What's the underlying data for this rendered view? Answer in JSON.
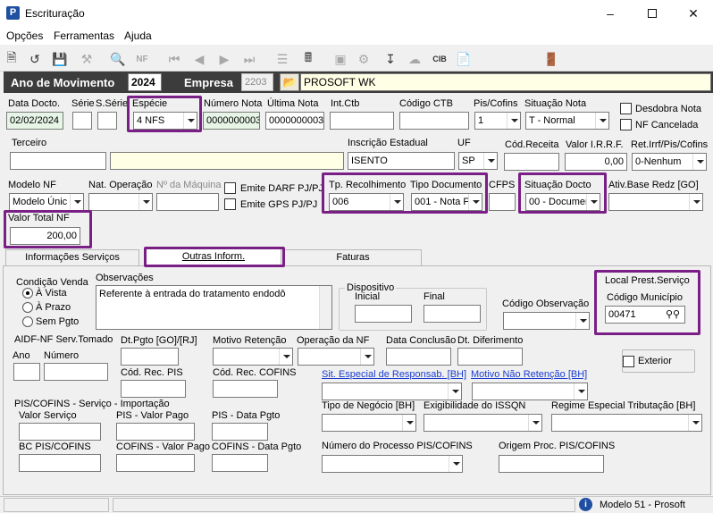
{
  "window": {
    "title": "Escrituração"
  },
  "menu": [
    "Opções",
    "Ferramentas",
    "Ajuda"
  ],
  "header": {
    "ano_label": "Ano de Movimento",
    "ano_value": "2024",
    "empresa_label": "Empresa",
    "empresa_code": "2203",
    "empresa_name": "PROSOFT WK"
  },
  "row1": {
    "data_docto_label": "Data Docto.",
    "data_docto": "02/02/2024",
    "serie_label": "Série",
    "sserie_label": "S.Série",
    "especie_label": "Espécie",
    "especie": "4 NFS",
    "numero_nota_label": "Número Nota",
    "numero_nota": "0000000003",
    "ultima_nota_label": "Última Nota",
    "ultima_nota": "0000000003",
    "int_ctb_label": "Int.Ctb",
    "codigo_ctb_label": "Código CTB",
    "pis_cofins_label": "Pis/Cofins",
    "pis_cofins": "1",
    "situacao_nota_label": "Situação Nota",
    "situacao_nota": "T - Normal",
    "desdobra_label": "Desdobra Nota",
    "nf_cancelada_label": "NF Cancelada"
  },
  "row2": {
    "terceiro_label": "Terceiro",
    "ie_label": "Inscrição Estadual",
    "ie": "ISENTO",
    "uf_label": "UF",
    "uf": "SP",
    "cod_receita_label": "Cód.Receita",
    "valor_irrf_label": "Valor I.R.R.F.",
    "valor_irrf": "0,00",
    "ret_label": "Ret.Irrf/Pis/Cofins",
    "ret": "0-Nenhum"
  },
  "row3": {
    "modelo_nf_label": "Modelo NF",
    "modelo_nf": "Modelo Únic",
    "nat_op_label": "Nat. Operação",
    "maquina_label": "Nº da Máquina",
    "darf_label": "Emite DARF PJ/PJ",
    "gps_label": "Emite GPS PJ/PJ",
    "tp_recolhimento_label": "Tp. Recolhimento",
    "tp_recolhimento": "006",
    "tipo_documento_label": "Tipo Documento",
    "tipo_documento": "001 - Nota F",
    "cfps_label": "CFPS",
    "situacao_docto_label": "Situação Docto",
    "situacao_docto": "00 - Documer",
    "ativ_label": "Ativ.Base Redz [GO]"
  },
  "valor_total": {
    "label": "Valor Total NF",
    "value": "200,00"
  },
  "tabs": [
    "Informações Serviços",
    "Outras Inform.",
    "Faturas"
  ],
  "condicao": {
    "title": "Condição Venda",
    "options": [
      "À Vista",
      "À Prazo",
      "Sem Pgto"
    ]
  },
  "observacoes": {
    "label": "Observações",
    "text": "Referente à entrada do tratamento endodô"
  },
  "dispositivo": {
    "title": "Dispositivo",
    "inicial": "Inicial",
    "final": "Final"
  },
  "codigo_observacao_label": "Código Observação",
  "local": {
    "title": "Local Prest.Serviço",
    "municipio_label": "Código Município",
    "municipio": "00471"
  },
  "aidf": {
    "title": "AIDF-NF Serv.Tomado",
    "ano": "Ano",
    "numero": "Número"
  },
  "mid": {
    "dt_pgto_label": "Dt.Pgto [GO]/[RJ]",
    "motivo_retencao_label": "Motivo Retenção",
    "op_nf_label": "Operação da NF",
    "data_conclusao_label": "Data Conclusão",
    "dt_diferimento_label": "Dt. Diferimento",
    "cod_rec_pis_label": "Cód. Rec. PIS",
    "cod_rec_cofins_label": "Cód. Rec. COFINS",
    "exterior_label": "Exterior",
    "sit_especial_label": "Sit. Especial de Responsab. [BH]",
    "motivo_nao_ret_label": "Motivo Não Retenção [BH]"
  },
  "pis_imp": {
    "title": "PIS/COFINS - Serviço - Importação",
    "valor_servico": "Valor Serviço",
    "pis_valor_pago": "PIS - Valor Pago",
    "pis_data": "PIS - Data Pgto",
    "bc": "BC PIS/COFINS",
    "cofins_valor": "COFINS - Valor Pago",
    "cofins_data": "COFINS - Data Pgto"
  },
  "bottom": {
    "tipo_negocio_label": "Tipo de Negócio [BH]",
    "exigibilidade_label": "Exigibilidade do ISSQN",
    "regime_label": "Regime Especial Tributação [BH]",
    "num_processo_label": "Número do Processo PIS/COFINS",
    "origem_label": "Origem Proc. PIS/COFINS"
  },
  "status": {
    "text": "Modelo 51 - Prosoft"
  },
  "colors": {
    "highlight": "#7a1f86",
    "header_bg": "#3c3c3c",
    "link": "#1a3ccf"
  }
}
